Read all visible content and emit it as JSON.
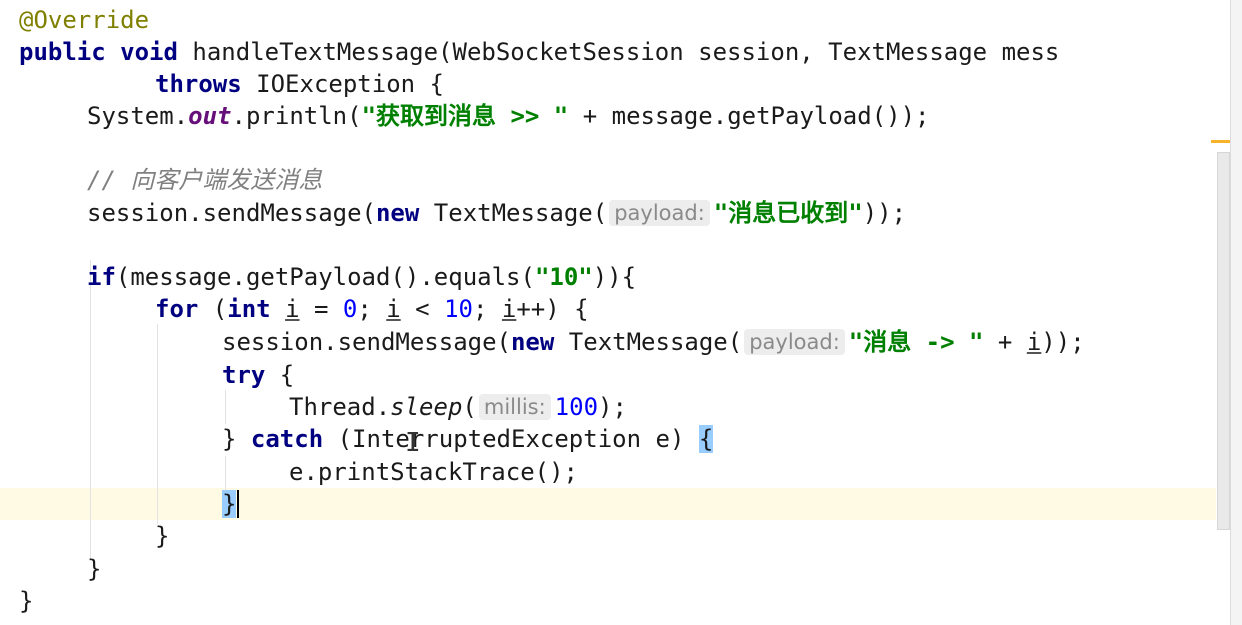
{
  "code": {
    "annotation": "@Override",
    "kw_public": "public",
    "kw_void": "void",
    "method_name": "handleTextMessage(WebSocketSession session, TextMessage mess",
    "kw_throws": "throws",
    "throws_rest": "IOException {",
    "sysout_prefix": "System.",
    "sysout_field": "out",
    "sysout_call": ".println(",
    "sysout_string": "\"获取到消息 >> \"",
    "sysout_rest": " + message.getPayload());",
    "comment": "// 向客户端发送消息",
    "send1_prefix": "session.sendMessage(",
    "kw_new": "new",
    "textmessage_open": " TextMessage(",
    "hint_payload": "payload:",
    "send1_string": "\"消息已收到\"",
    "send1_close": "));",
    "kw_if": "if",
    "if_cond": "(message.getPayload().equals(",
    "if_string": "\"10\"",
    "if_close": ")){",
    "kw_for": "for",
    "for_open": " (",
    "kw_int": "int",
    "for_var": "i",
    "for_eq": " = ",
    "num_zero": "0",
    "for_semi1": "; ",
    "for_lt": " < ",
    "num_ten": "10",
    "for_semi2": "; ",
    "for_inc": "++) {",
    "send2_prefix": "session.sendMessage(",
    "send2_string": "\"消息 -> \"",
    "send2_plus": " + ",
    "send2_close": "));",
    "kw_try": "try",
    "brace_open": " {",
    "sleep_prefix": "Thread.",
    "sleep_method": "sleep",
    "sleep_open": "(",
    "hint_millis": "millis:",
    "num_hundred": "100",
    "sleep_close": ");",
    "catch_prefix": "} ",
    "kw_catch": "catch",
    "catch_rest": " (InterruptedException e) ",
    "brace_match_open": "{",
    "print_stack": "e.printStackTrace();",
    "brace_match_close": "}",
    "close_brace": "}"
  }
}
